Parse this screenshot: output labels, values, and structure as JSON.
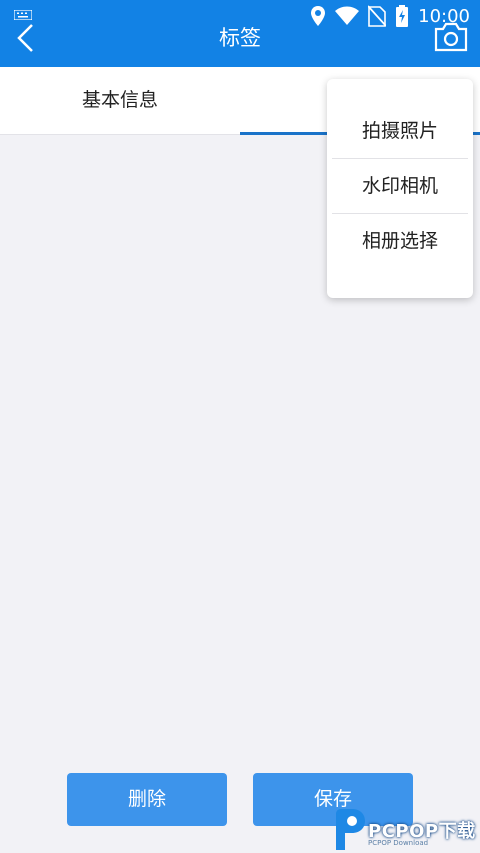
{
  "status_bar": {
    "time": "10:00"
  },
  "app_bar": {
    "title": "标签"
  },
  "tabs": [
    {
      "label": "基本信息"
    },
    {
      "label": ""
    }
  ],
  "camera_menu": {
    "items": [
      {
        "label": "拍摄照片"
      },
      {
        "label": "水印相机"
      },
      {
        "label": "相册选择"
      }
    ]
  },
  "actions": {
    "delete_label": "删除",
    "save_label": "保存"
  },
  "watermark": {
    "text": "PCPOP下载",
    "sub": "PCPOP Download"
  },
  "colors": {
    "primary": "#1282e5",
    "button": "#3d94eb",
    "background": "#f2f2f6"
  }
}
